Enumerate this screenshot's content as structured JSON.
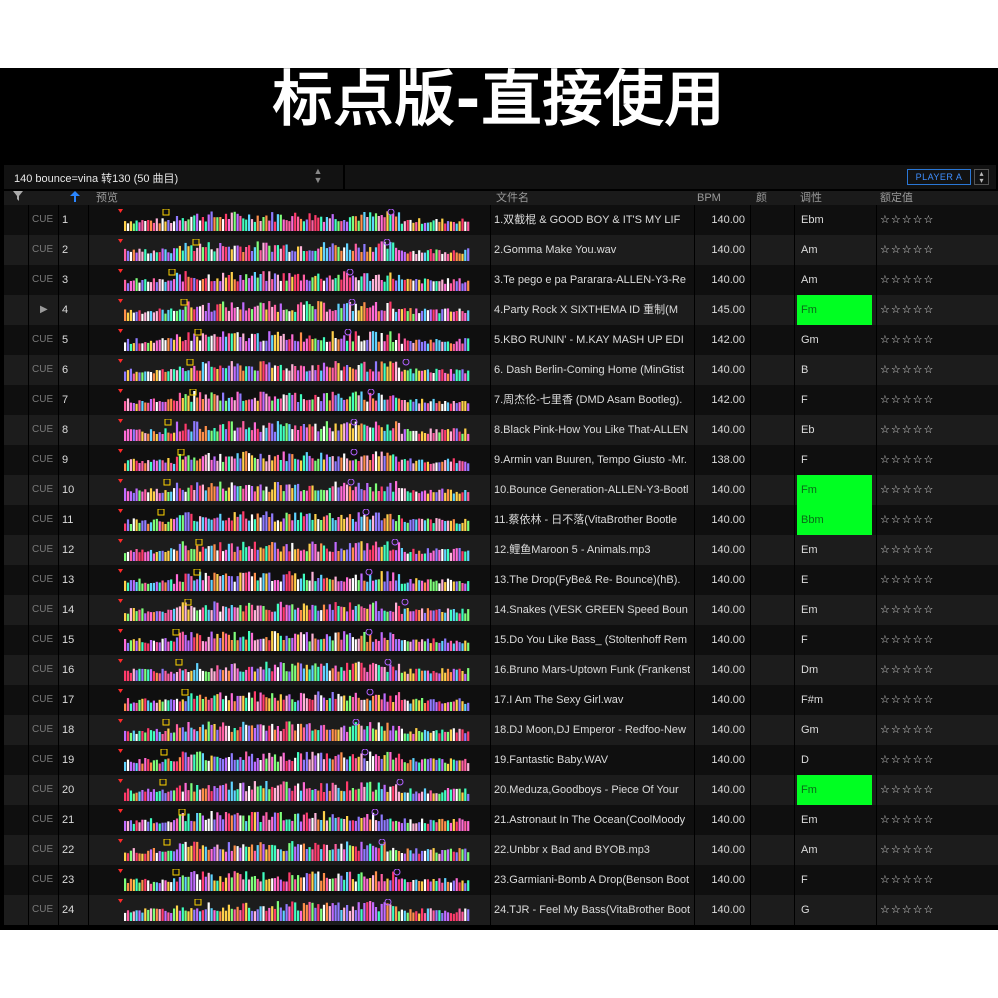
{
  "banner": {
    "title": "标点版-直接使用"
  },
  "playlist": {
    "title": "140 bounce=vina 转130 (50 曲目)",
    "player_button": "PLAYER A"
  },
  "icons": {
    "filter": "filter-icon",
    "sort": "sort-up-arrow-icon",
    "playing": "play-triangle-icon",
    "rating": "star-outline-icon"
  },
  "headers": {
    "preview": "预览",
    "filename": "文件名",
    "bpm": "BPM",
    "color": "颜",
    "key": "调性",
    "rating": "额定值"
  },
  "colors": {
    "key_highlight": "#00ff22",
    "player_accent": "#2a77d6"
  },
  "rows": [
    {
      "cue": "CUE",
      "num": "1",
      "name": "1.双截棍 & GOOD BOY & IT'S MY LIF",
      "bpm": "140.00",
      "key": "Ebm",
      "hl": false,
      "stars": "☆☆☆☆☆"
    },
    {
      "cue": "CUE",
      "num": "2",
      "name": "2.Gomma Make You.wav",
      "bpm": "140.00",
      "key": "Am",
      "hl": false,
      "stars": "☆☆☆☆☆"
    },
    {
      "cue": "CUE",
      "num": "3",
      "name": "3.Te pego e pa Pararara-ALLEN-Y3-Re",
      "bpm": "140.00",
      "key": "Am",
      "hl": false,
      "stars": "☆☆☆☆☆"
    },
    {
      "cue": "▶",
      "num": "4",
      "name": "4.Party Rock X SIXTHEMA ID 重制(M",
      "bpm": "145.00",
      "key": "Fm",
      "hl": true,
      "stars": "☆☆☆☆☆"
    },
    {
      "cue": "CUE",
      "num": "5",
      "name": "5.KBO RUNIN'  - M.KAY MASH UP EDI",
      "bpm": "142.00",
      "key": "Gm",
      "hl": false,
      "stars": "☆☆☆☆☆"
    },
    {
      "cue": "CUE",
      "num": "6",
      "name": "6. Dash Berlin-Coming Home (MinGtist",
      "bpm": "140.00",
      "key": "B",
      "hl": false,
      "stars": "☆☆☆☆☆"
    },
    {
      "cue": "CUE",
      "num": "7",
      "name": "7.周杰伦-七里香 (DMD Asam Bootleg).",
      "bpm": "142.00",
      "key": "F",
      "hl": false,
      "stars": "☆☆☆☆☆"
    },
    {
      "cue": "CUE",
      "num": "8",
      "name": "8.Black Pink-How You Like That-ALLEN",
      "bpm": "140.00",
      "key": "Eb",
      "hl": false,
      "stars": "☆☆☆☆☆"
    },
    {
      "cue": "CUE",
      "num": "9",
      "name": "9.Armin van Buuren, Tempo Giusto -Mr.",
      "bpm": "138.00",
      "key": "F",
      "hl": false,
      "stars": "☆☆☆☆☆"
    },
    {
      "cue": "CUE",
      "num": "10",
      "name": "10.Bounce Generation-ALLEN-Y3-Bootl",
      "bpm": "140.00",
      "key": "Fm",
      "hl": true,
      "stars": "☆☆☆☆☆"
    },
    {
      "cue": "CUE",
      "num": "11",
      "name": "11.蔡依林 - 日不落(VitaBrother Bootle",
      "bpm": "140.00",
      "key": "Bbm",
      "hl": true,
      "stars": "☆☆☆☆☆"
    },
    {
      "cue": "CUE",
      "num": "12",
      "name": "12.鲤鱼Maroon 5 - Animals.mp3",
      "bpm": "140.00",
      "key": "Em",
      "hl": false,
      "stars": "☆☆☆☆☆"
    },
    {
      "cue": "CUE",
      "num": "13",
      "name": "13.The Drop(FyBe&  Re- Bounce)(hB).",
      "bpm": "140.00",
      "key": "E",
      "hl": false,
      "stars": "☆☆☆☆☆"
    },
    {
      "cue": "CUE",
      "num": "14",
      "name": "14.Snakes (VESK GREEN Speed Boun",
      "bpm": "140.00",
      "key": "Em",
      "hl": false,
      "stars": "☆☆☆☆☆"
    },
    {
      "cue": "CUE",
      "num": "15",
      "name": "15.Do You Like Bass_ (Stoltenhoff Rem",
      "bpm": "140.00",
      "key": "F",
      "hl": false,
      "stars": "☆☆☆☆☆"
    },
    {
      "cue": "CUE",
      "num": "16",
      "name": "16.Bruno Mars-Uptown Funk (Frankenst",
      "bpm": "140.00",
      "key": "Dm",
      "hl": false,
      "stars": "☆☆☆☆☆"
    },
    {
      "cue": "CUE",
      "num": "17",
      "name": "17.I Am The Sexy Girl.wav",
      "bpm": "140.00",
      "key": "F#m",
      "hl": false,
      "stars": "☆☆☆☆☆"
    },
    {
      "cue": "CUE",
      "num": "18",
      "name": "18.DJ Moon,DJ Emperor - Redfoo-New",
      "bpm": "140.00",
      "key": "Gm",
      "hl": false,
      "stars": "☆☆☆☆☆"
    },
    {
      "cue": "CUE",
      "num": "19",
      "name": "19.Fantastic Baby.WAV",
      "bpm": "140.00",
      "key": "D",
      "hl": false,
      "stars": "☆☆☆☆☆"
    },
    {
      "cue": "CUE",
      "num": "20",
      "name": "20.Meduza,Goodboys - Piece Of Your",
      "bpm": "140.00",
      "key": "Fm",
      "hl": true,
      "stars": "☆☆☆☆☆"
    },
    {
      "cue": "CUE",
      "num": "21",
      "name": "21.Astronaut In The Ocean(CoolMoody",
      "bpm": "140.00",
      "key": "Em",
      "hl": false,
      "stars": "☆☆☆☆☆"
    },
    {
      "cue": "CUE",
      "num": "22",
      "name": "22.Unbbr x Bad and BYOB.mp3",
      "bpm": "140.00",
      "key": "Am",
      "hl": false,
      "stars": "☆☆☆☆☆"
    },
    {
      "cue": "CUE",
      "num": "23",
      "name": "23.Garmiani-Bomb A Drop(Benson Boot",
      "bpm": "140.00",
      "key": "F",
      "hl": false,
      "stars": "☆☆☆☆☆"
    },
    {
      "cue": "CUE",
      "num": "24",
      "name": "24.TJR - Feel My Bass(VitaBrother Boot",
      "bpm": "140.00",
      "key": "G",
      "hl": false,
      "stars": "☆☆☆☆☆"
    }
  ]
}
